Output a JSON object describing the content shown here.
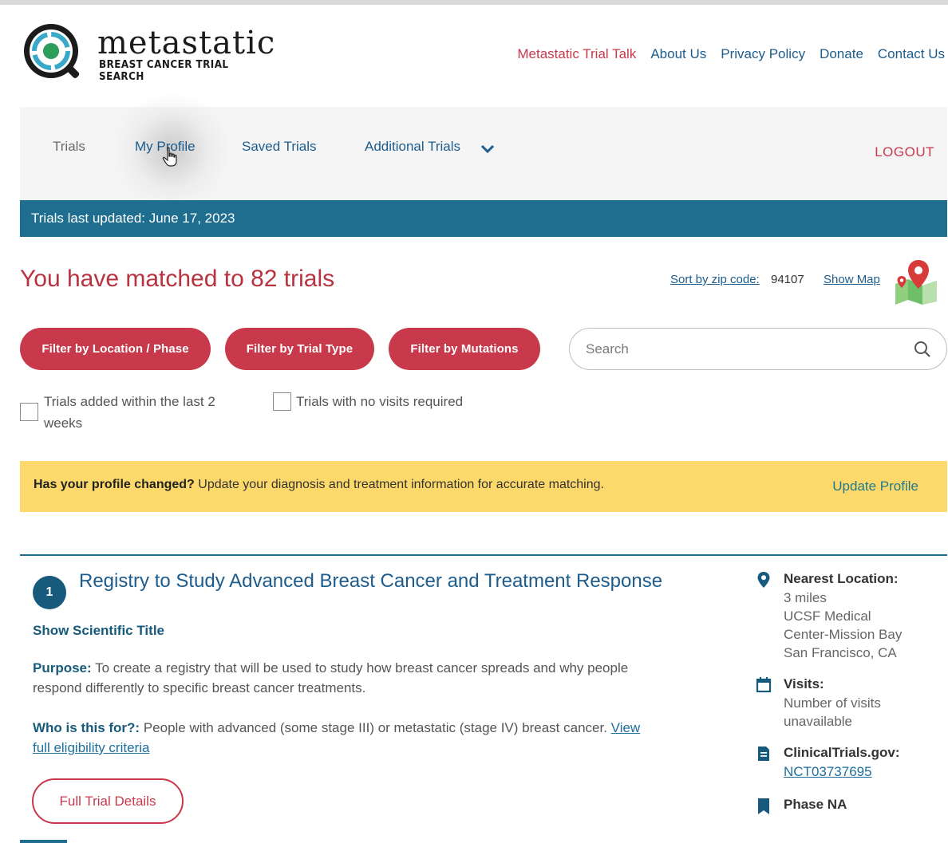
{
  "logo": {
    "title": "metastatic",
    "subtitle": "BREAST CANCER TRIAL SEARCH"
  },
  "top_nav": [
    {
      "label": "Metastatic Trial Talk",
      "accent": true
    },
    {
      "label": "About Us"
    },
    {
      "label": "Privacy Policy"
    },
    {
      "label": "Donate"
    },
    {
      "label": "Contact Us"
    }
  ],
  "tabs": {
    "trials": "Trials",
    "my_profile": "My Profile",
    "saved_trials": "Saved Trials",
    "additional_trials": "Additional Trials",
    "logout": "LOGOUT"
  },
  "update_bar": "Trials last updated: June 17, 2023",
  "match_heading": "You have matched to 82 trials",
  "sort": {
    "label": "Sort by zip code:",
    "zip": "94107",
    "show_map": "Show Map"
  },
  "filters": {
    "location_phase": "Filter by Location / Phase",
    "trial_type": "Filter by Trial Type",
    "mutations": "Filter by Mutations"
  },
  "search": {
    "placeholder": "Search",
    "value": ""
  },
  "checkboxes": {
    "recent_line1": "Trials added within the last 2",
    "recent_line2": "weeks",
    "no_visits": "Trials with no visits required"
  },
  "profile_banner": {
    "bold": "Has your profile changed?",
    "text": " Update your diagnosis and treatment information for accurate matching.",
    "link": "Update Profile"
  },
  "trial": {
    "number": "1",
    "title": "Registry to Study Advanced Breast Cancer and Treatment Response",
    "show_scientific": "Show Scientific Title",
    "purpose_label": "Purpose:",
    "purpose_line1": " To create a registry that will be used to study how breast cancer spreads and why people",
    "purpose_line2": "respond differently to specific breast cancer treatments.",
    "who_label": "Who is this for?:",
    "who_text": " People with advanced (some stage III) or metastatic (stage IV) breast cancer. ",
    "who_link1": "View",
    "who_link2": "full eligibility criteria",
    "details_button": "Full Trial Details",
    "nearest_label": "Nearest Location:",
    "nearest_distance": "3 miles",
    "nearest_line1": "UCSF Medical",
    "nearest_line2": "Center-Mission Bay",
    "nearest_line3": "San Francisco, CA",
    "visits_label": "Visits:",
    "visits_line1": "Number of visits",
    "visits_line2": "unavailable",
    "ct_label": "ClinicalTrials.gov:",
    "ct_id": "NCT03737695",
    "phase": "Phase NA"
  },
  "colors": {
    "brand_red": "#c8394b",
    "brand_blue": "#1d5c8c",
    "bar_teal": "#1f6e8f",
    "banner_yellow": "#fcd96a"
  }
}
